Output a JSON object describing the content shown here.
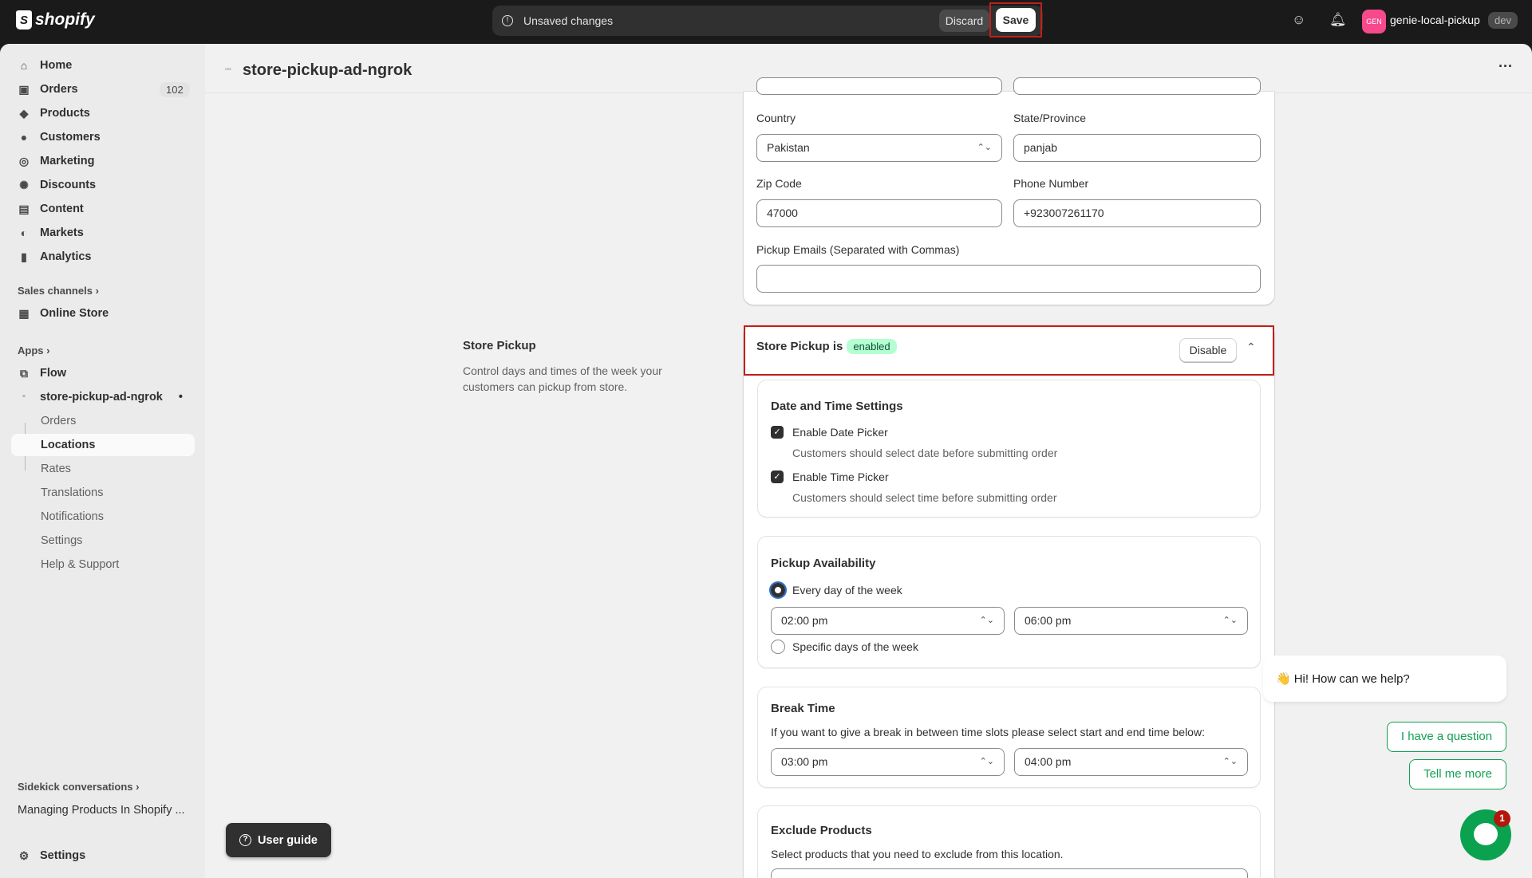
{
  "topbar": {
    "brand": "shopify",
    "unsaved": "Unsaved changes",
    "discard": "Discard",
    "save": "Save",
    "avatar_initials": "GEN",
    "shop_name": "genie-local-pickup",
    "env_badge": "dev"
  },
  "sidebar": {
    "items": [
      {
        "label": "Home",
        "icon": "home-icon"
      },
      {
        "label": "Orders",
        "icon": "orders-icon",
        "badge": "102"
      },
      {
        "label": "Products",
        "icon": "tag-icon"
      },
      {
        "label": "Customers",
        "icon": "person-icon"
      },
      {
        "label": "Marketing",
        "icon": "target-icon"
      },
      {
        "label": "Discounts",
        "icon": "discount-icon"
      },
      {
        "label": "Content",
        "icon": "content-icon"
      },
      {
        "label": "Markets",
        "icon": "globe-icon"
      },
      {
        "label": "Analytics",
        "icon": "bar-chart-icon"
      }
    ],
    "sales_channels": "Sales channels",
    "online_store": "Online Store",
    "apps": "Apps",
    "flow": "Flow",
    "app_name": "store-pickup-ad-ngrok",
    "app_sub": [
      "Orders",
      "Locations",
      "Rates",
      "Translations",
      "Notifications",
      "Settings",
      "Help & Support"
    ],
    "sidekick": "Sidekick conversations",
    "conversation": "Managing Products In Shopify ...",
    "settings": "Settings"
  },
  "page": {
    "title": "store-pickup-ad-ngrok"
  },
  "address": {
    "country_label": "Country",
    "country_value": "Pakistan",
    "state_label": "State/Province",
    "state_value": "panjab",
    "zip_label": "Zip Code",
    "zip_value": "47000",
    "phone_label": "Phone Number",
    "phone_value": "+923007261170",
    "emails_label": "Pickup Emails (Separated with Commas)",
    "emails_value": ""
  },
  "store_pickup": {
    "section_title": "Store Pickup",
    "section_desc": "Control days and times of the week your customers can pickup from store.",
    "status_prefix": "Store Pickup is",
    "status": "enabled",
    "disable": "Disable",
    "datetime": {
      "title": "Date and Time Settings",
      "date_label": "Enable Date Picker",
      "date_help": "Customers should select date before submitting order",
      "time_label": "Enable Time Picker",
      "time_help": "Customers should select time before submitting order"
    },
    "availability": {
      "title": "Pickup Availability",
      "every_day": "Every day of the week",
      "start": "02:00 pm",
      "end": "06:00 pm",
      "specific": "Specific days of the week"
    },
    "break": {
      "title": "Break Time",
      "desc": "If you want to give a break in between time slots please select start and end time below:",
      "start": "03:00 pm",
      "end": "04:00 pm"
    },
    "exclude": {
      "title": "Exclude Products",
      "desc": "Select products that you need to exclude from this location."
    }
  },
  "user_guide": "User guide",
  "chat": {
    "greeting": "Hi! How can we help?",
    "option1": "I have a question",
    "option2": "Tell me more",
    "unread": "1"
  },
  "colors": {
    "accent_red": "#c0201a",
    "enabled_badge": "#b4fed2",
    "chat_green": "#12a150"
  }
}
